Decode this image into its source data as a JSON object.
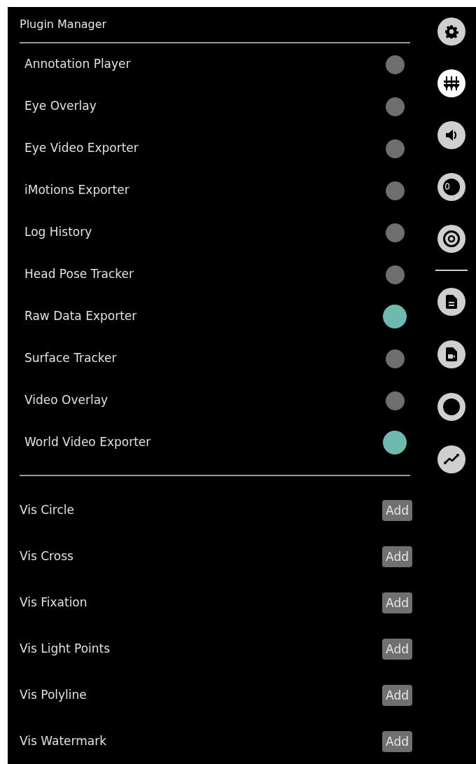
{
  "panel": {
    "title": "Plugin Manager"
  },
  "plugins": [
    {
      "label": "Annotation Player",
      "on": false
    },
    {
      "label": "Eye Overlay",
      "on": false
    },
    {
      "label": "Eye Video Exporter",
      "on": false
    },
    {
      "label": "iMotions Exporter",
      "on": false
    },
    {
      "label": "Log History",
      "on": false
    },
    {
      "label": "Head Pose Tracker",
      "on": false
    },
    {
      "label": "Raw Data Exporter",
      "on": true
    },
    {
      "label": "Surface Tracker",
      "on": false
    },
    {
      "label": "Video Overlay",
      "on": false
    },
    {
      "label": "World Video Exporter",
      "on": true
    }
  ],
  "visualizers": [
    {
      "label": "Vis Circle",
      "button": "Add"
    },
    {
      "label": "Vis Cross",
      "button": "Add"
    },
    {
      "label": "Vis Fixation",
      "button": "Add"
    },
    {
      "label": "Vis Light Points",
      "button": "Add"
    },
    {
      "label": "Vis Polyline",
      "button": "Add"
    },
    {
      "label": "Vis Watermark",
      "button": "Add"
    }
  ],
  "sidebar": {
    "top": [
      {
        "kind": "gear",
        "selected": false
      },
      {
        "kind": "sliders",
        "selected": true
      },
      {
        "kind": "speaker",
        "selected": false
      },
      {
        "kind": "eye",
        "selected": false
      },
      {
        "kind": "target",
        "selected": false
      }
    ],
    "bottom": [
      {
        "kind": "document",
        "selected": false
      },
      {
        "kind": "video-file",
        "selected": false
      },
      {
        "kind": "ring",
        "selected": false
      },
      {
        "kind": "chart",
        "selected": false
      }
    ]
  }
}
